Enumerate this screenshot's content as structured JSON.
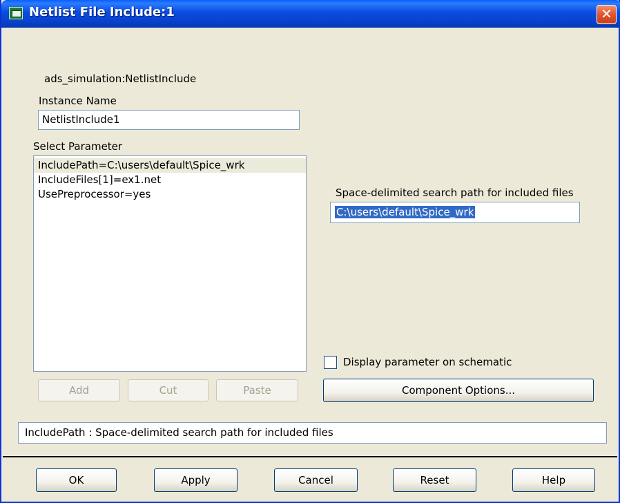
{
  "window": {
    "title": "Netlist File Include:1"
  },
  "component": {
    "type_label": "ads_simulation:NetlistInclude"
  },
  "instance": {
    "label": "Instance Name",
    "value": "NetlistInclude1"
  },
  "parameters": {
    "label": "Select Parameter",
    "items": [
      "IncludePath=C:\\users\\default\\Spice_wrk",
      "IncludeFiles[1]=ex1.net",
      "UsePreprocessor=yes"
    ],
    "selected_index": 0,
    "add_label": "Add",
    "cut_label": "Cut",
    "paste_label": "Paste"
  },
  "editor": {
    "label": "Space-delimited search path for included files",
    "value": "C:\\users\\default\\Spice_wrk",
    "display_checkbox_label": "Display parameter on schematic",
    "display_checked": false,
    "component_options_label": "Component Options..."
  },
  "status": {
    "text": "IncludePath : Space-delimited search path for included files"
  },
  "footer": {
    "ok_label": "OK",
    "apply_label": "Apply",
    "cancel_label": "Cancel",
    "reset_label": "Reset",
    "help_label": "Help"
  }
}
